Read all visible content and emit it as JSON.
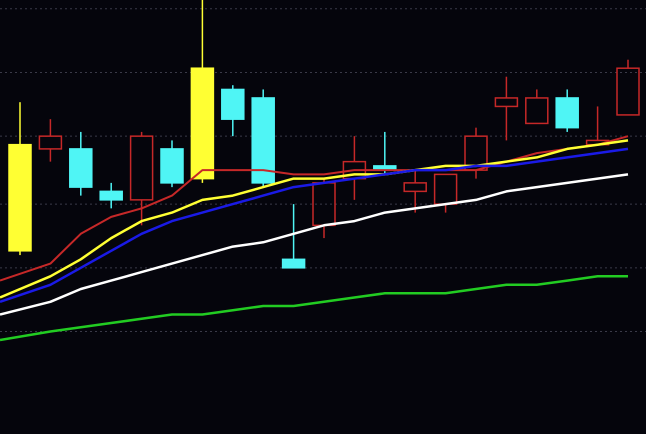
{
  "chart_data": {
    "type": "candlestick",
    "title": "",
    "xlabel": "",
    "ylabel": "",
    "ylim": [
      45,
      126
    ],
    "grid": true,
    "grid_style": "dotted",
    "grid_levels": [
      127,
      112,
      97,
      81,
      66,
      51
    ],
    "background_color": "#05050c",
    "colors": {
      "up": "#c62828",
      "down": "#4ff5f5",
      "yellow_bar": "#ffff33",
      "grid": "#3a3a48"
    },
    "candles": [
      {
        "open": 70,
        "high": 105,
        "low": 69,
        "close": 95,
        "color": "yellow"
      },
      {
        "open": 94,
        "high": 101,
        "low": 91,
        "close": 97,
        "color": "up"
      },
      {
        "open": 94,
        "high": 98,
        "low": 83,
        "close": 85,
        "color": "down"
      },
      {
        "open": 84,
        "high": 86,
        "low": 80,
        "close": 82,
        "color": "down"
      },
      {
        "open": 82,
        "high": 98,
        "low": 76,
        "close": 97,
        "color": "up"
      },
      {
        "open": 94,
        "high": 96,
        "low": 85,
        "close": 86,
        "color": "down"
      },
      {
        "open": 87,
        "high": 143,
        "low": 86,
        "close": 113,
        "color": "yellow"
      },
      {
        "open": 108,
        "high": 109,
        "low": 97,
        "close": 101,
        "color": "down"
      },
      {
        "open": 106,
        "high": 108,
        "low": 85,
        "close": 86,
        "color": "down"
      },
      {
        "open": 68,
        "high": 81,
        "low": 67,
        "close": 66,
        "color": "down"
      },
      {
        "open": 76,
        "high": 87,
        "low": 73,
        "close": 86,
        "color": "up"
      },
      {
        "open": 87,
        "high": 97,
        "low": 82,
        "close": 91,
        "color": "up"
      },
      {
        "open": 90,
        "high": 98,
        "low": 88,
        "close": 89,
        "color": "down"
      },
      {
        "open": 84,
        "high": 89,
        "low": 79,
        "close": 86,
        "color": "up"
      },
      {
        "open": 81,
        "high": 88,
        "low": 79,
        "close": 88,
        "color": "up"
      },
      {
        "open": 89,
        "high": 99,
        "low": 87,
        "close": 97,
        "color": "up"
      },
      {
        "open": 104,
        "high": 111,
        "low": 96,
        "close": 106,
        "color": "up"
      },
      {
        "open": 100,
        "high": 108,
        "low": 100,
        "close": 106,
        "color": "up"
      },
      {
        "open": 106,
        "high": 108,
        "low": 98,
        "close": 99,
        "color": "down"
      },
      {
        "open": 95,
        "high": 104,
        "low": 95,
        "close": 96,
        "color": "up"
      },
      {
        "open": 102,
        "high": 115,
        "low": 102,
        "close": 113,
        "color": "up"
      }
    ],
    "series": [
      {
        "color": "#c62828",
        "values": [
          63,
          67,
          74,
          78,
          80,
          83,
          89,
          89,
          89,
          88,
          88,
          89,
          89,
          89,
          89,
          89,
          91,
          93,
          94,
          95,
          97
        ]
      },
      {
        "color": "#ffff33",
        "values": [
          59,
          64,
          68,
          73,
          77,
          79,
          82,
          83,
          85,
          87,
          87,
          88,
          88,
          89,
          90,
          90,
          91,
          92,
          94,
          95,
          96
        ]
      },
      {
        "color": "#1a1ae6",
        "values": [
          58,
          62,
          66,
          70,
          74,
          77,
          79,
          81,
          83,
          85,
          86,
          87,
          88,
          89,
          89,
          90,
          90,
          91,
          92,
          93,
          94
        ]
      },
      {
        "color": "#ffffff",
        "values": [
          55,
          58,
          61,
          63,
          65,
          67,
          69,
          71,
          72,
          74,
          76,
          77,
          79,
          80,
          81,
          82,
          84,
          85,
          86,
          87,
          88
        ]
      },
      {
        "color": "#22cc22",
        "values": [
          49,
          51,
          52,
          53,
          54,
          55,
          55,
          56,
          57,
          57,
          58,
          59,
          60,
          60,
          60,
          61,
          62,
          62,
          63,
          64,
          64
        ]
      }
    ]
  }
}
